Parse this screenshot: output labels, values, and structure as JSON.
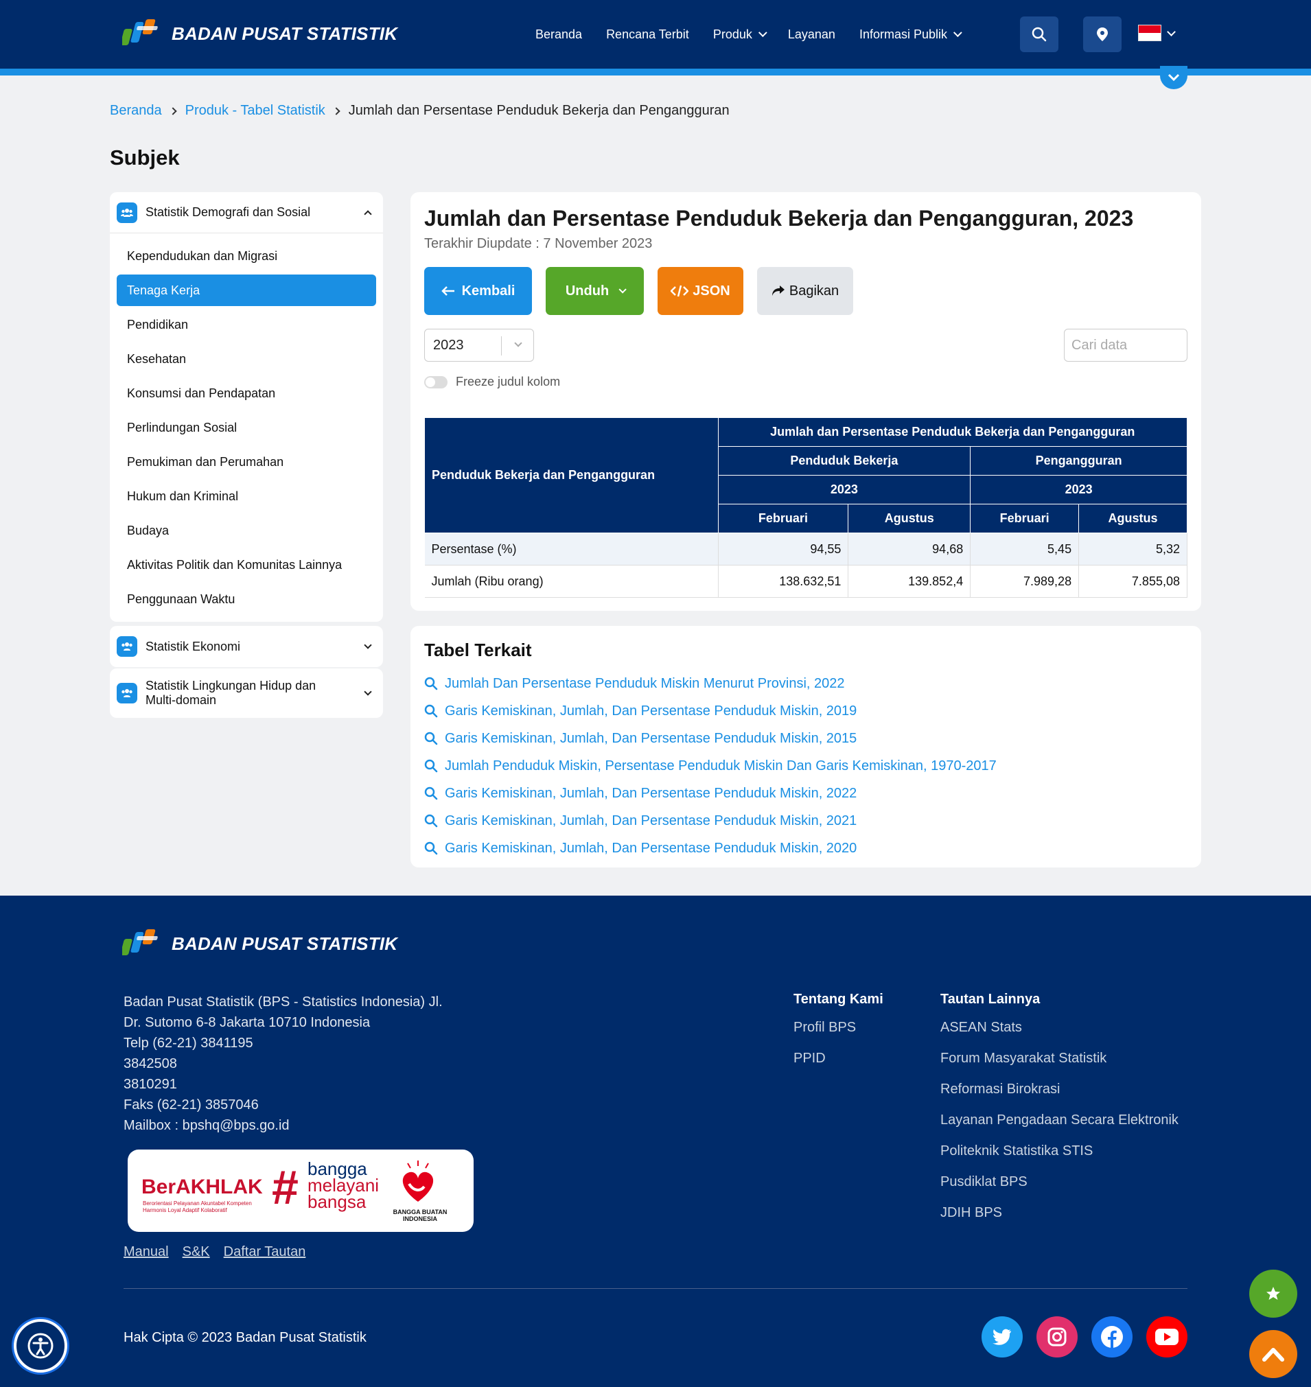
{
  "header": {
    "logo_text": "BADAN PUSAT STATISTIK",
    "nav": [
      {
        "label": "Beranda",
        "dropdown": false
      },
      {
        "label": "Rencana Terbit",
        "dropdown": false
      },
      {
        "label": "Produk",
        "dropdown": true
      },
      {
        "label": "Layanan",
        "dropdown": false
      },
      {
        "label": "Informasi Publik",
        "dropdown": true
      }
    ],
    "icons": {
      "search": "search-icon",
      "location": "map-pin-icon",
      "language": "indonesia-flag-icon"
    }
  },
  "breadcrumb": {
    "home": "Beranda",
    "section": "Produk - Tabel Statistik",
    "current": "Jumlah dan Persentase Penduduk Bekerja dan Pengangguran"
  },
  "sidebar": {
    "title": "Subjek",
    "groups": [
      {
        "label": "Statistik Demografi dan Sosial",
        "expanded": true,
        "items": [
          "Kependudukan dan Migrasi",
          "Tenaga Kerja",
          "Pendidikan",
          "Kesehatan",
          "Konsumsi dan Pendapatan",
          "Perlindungan Sosial",
          "Pemukiman dan Perumahan",
          "Hukum dan Kriminal",
          "Budaya",
          "Aktivitas Politik dan Komunitas Lainnya",
          "Penggunaan Waktu"
        ],
        "active_item": "Tenaga Kerja"
      },
      {
        "label": "Statistik Ekonomi",
        "expanded": false
      },
      {
        "label": "Statistik Lingkungan Hidup dan Multi-domain",
        "expanded": false
      }
    ]
  },
  "main": {
    "title": "Jumlah dan Persentase Penduduk Bekerja dan Pengangguran, 2023",
    "updated": "Terakhir Diupdate : 7 November 2023",
    "buttons": {
      "back": "Kembali",
      "download": "Unduh",
      "json": "JSON",
      "share": "Bagikan"
    },
    "year_select": "2023",
    "search_placeholder": "Cari data",
    "freeze_label": "Freeze judul kolom",
    "table": {
      "row_header": "Penduduk Bekerja dan Pengangguran",
      "top_header": "Jumlah dan Persentase Penduduk Bekerja dan Pengangguran",
      "groups": [
        "Penduduk Bekerja",
        "Pengangguran"
      ],
      "years": [
        "2023",
        "2023"
      ],
      "periods": [
        "Februari",
        "Agustus",
        "Februari",
        "Agustus"
      ],
      "rows": [
        {
          "label": "Persentase (%)",
          "values": [
            "94,55",
            "94,68",
            "5,45",
            "5,32"
          ]
        },
        {
          "label": "Jumlah (Ribu orang)",
          "values": [
            "138.632,51",
            "139.852,4",
            "7.989,28",
            "7.855,08"
          ]
        }
      ]
    }
  },
  "related": {
    "title": "Tabel Terkait",
    "items": [
      "Jumlah Dan Persentase Penduduk Miskin Menurut Provinsi, 2022",
      "Garis Kemiskinan, Jumlah, Dan Persentase Penduduk Miskin, 2019",
      "Garis Kemiskinan, Jumlah, Dan Persentase Penduduk Miskin, 2015",
      "Jumlah Penduduk Miskin, Persentase Penduduk Miskin Dan Garis Kemiskinan, 1970-2017",
      "Garis Kemiskinan, Jumlah, Dan Persentase Penduduk Miskin, 2022",
      "Garis Kemiskinan, Jumlah, Dan Persentase Penduduk Miskin, 2021",
      "Garis Kemiskinan, Jumlah, Dan Persentase Penduduk Miskin, 2020"
    ]
  },
  "footer": {
    "logo_text": "BADAN PUSAT STATISTIK",
    "address_lines": [
      "Badan Pusat Statistik (BPS - Statistics Indonesia) Jl.",
      "Dr. Sutomo 6-8 Jakarta 10710 Indonesia",
      "Telp (62-21) 3841195",
      "3842508",
      "3810291",
      "Faks (62-21) 3857046",
      "Mailbox : bpshq@bps.go.id"
    ],
    "badges": {
      "berakhlak": "BerAKHLAK",
      "berakhlak_sub1": "Berorientasi Pelayanan Akuntabel Kompeten",
      "berakhlak_sub2": "Harmonis Loyal Adaptif Kolaboratif",
      "hashtag": "#",
      "bangga": "bangga",
      "melayani": "melayani",
      "bangsa": "bangsa",
      "bbi": "BANGGA BUATAN INDONESIA"
    },
    "bottom_links": [
      "Manual",
      "S&K",
      "Daftar Tautan"
    ],
    "about": {
      "title": "Tentang Kami",
      "items": [
        "Profil BPS",
        "PPID"
      ]
    },
    "other_links": {
      "title": "Tautan Lainnya",
      "items": [
        "ASEAN Stats",
        "Forum Masyarakat Statistik",
        "Reformasi Birokrasi",
        "Layanan Pengadaan Secara Elektronik",
        "Politeknik Statistika STIS",
        "Pusdiklat BPS",
        "JDIH BPS"
      ]
    },
    "copyright": "Hak Cipta © 2023 Badan Pusat Statistik",
    "social": [
      "twitter-icon",
      "instagram-icon",
      "facebook-icon",
      "youtube-icon"
    ]
  },
  "colors": {
    "navy": "#002b6a",
    "accent_blue": "#1a8fe3",
    "green": "#56a729",
    "orange": "#ef7d0d"
  }
}
